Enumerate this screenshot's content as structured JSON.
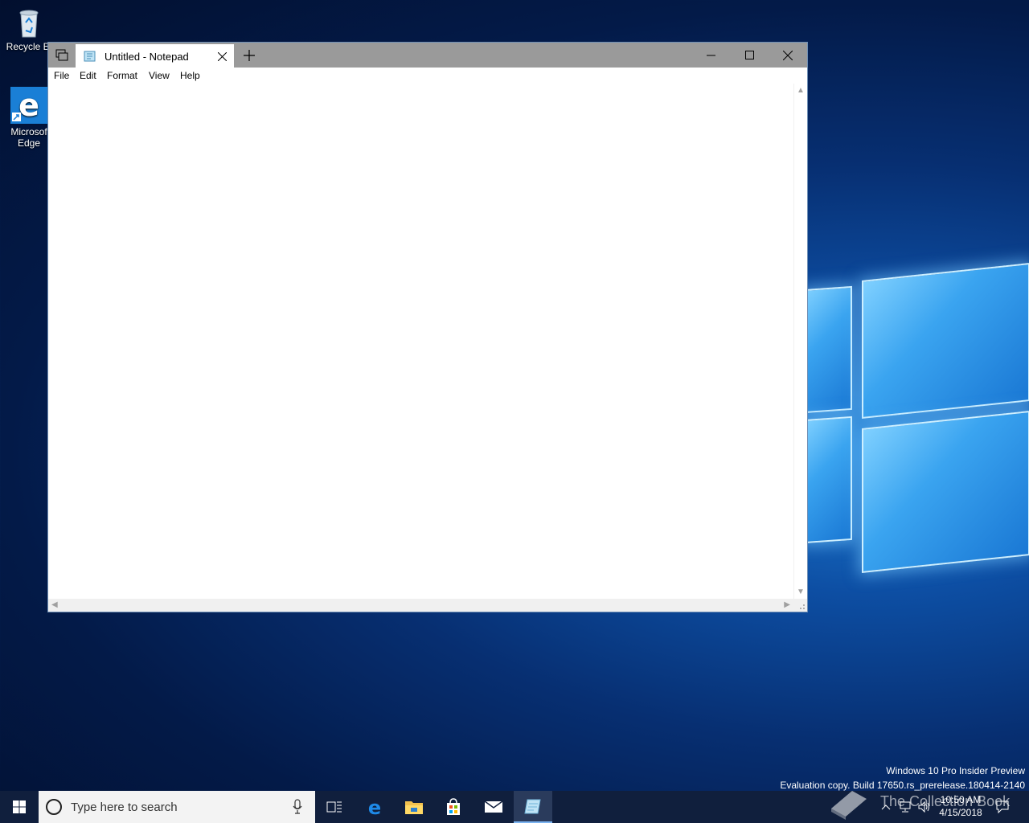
{
  "desktop": {
    "icons": [
      {
        "label": "Recycle Bi"
      },
      {
        "label": "Microsof Edge"
      }
    ]
  },
  "notepad": {
    "tab_title": "Untitled - Notepad",
    "menu": [
      "File",
      "Edit",
      "Format",
      "View",
      "Help"
    ]
  },
  "watermark": {
    "line1": "Windows 10 Pro Insider Preview",
    "line2": "Evaluation copy. Build 17650.rs_prerelease.180414-2140"
  },
  "taskbar": {
    "search_placeholder": "Type here to search",
    "time": "10:50 AM",
    "date": "4/15/2018",
    "overlay_text": "The Collection Book"
  },
  "colors": {
    "accent": "#0078d7",
    "taskbar": "#101f3d",
    "titlebar": "#9a9a9a"
  }
}
